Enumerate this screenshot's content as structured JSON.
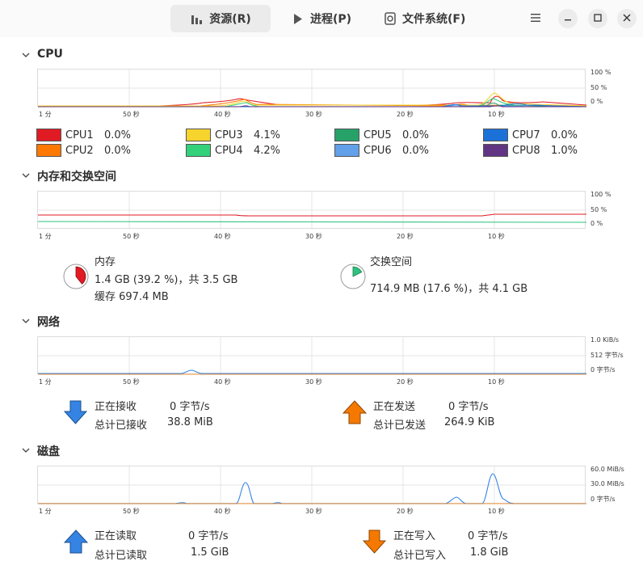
{
  "tabs": [
    {
      "label": "资源(R)",
      "icon": "bar-chart-icon",
      "active": true
    },
    {
      "label": "进程(P)",
      "icon": "play-icon",
      "active": false
    },
    {
      "label": "文件系统(F)",
      "icon": "disk-icon",
      "active": false
    }
  ],
  "window_buttons": [
    "menu-icon",
    "minimize-icon",
    "maximize-icon",
    "close-icon"
  ],
  "x_ticks": [
    "1 分",
    "50 秒",
    "40 秒",
    "30 秒",
    "20 秒",
    "10 秒"
  ],
  "cpu": {
    "title": "CPU",
    "y_ticks": [
      "100 %",
      "50 %",
      "0 %"
    ],
    "cores": [
      {
        "name": "CPU1",
        "value": "0.0%",
        "color": "#e01b24"
      },
      {
        "name": "CPU2",
        "value": "0.0%",
        "color": "#ff7800"
      },
      {
        "name": "CPU3",
        "value": "4.1%",
        "color": "#f6d32d"
      },
      {
        "name": "CPU4",
        "value": "4.2%",
        "color": "#33d17a"
      },
      {
        "name": "CPU5",
        "value": "0.0%",
        "color": "#26a269"
      },
      {
        "name": "CPU6",
        "value": "0.0%",
        "color": "#62a0ea"
      },
      {
        "name": "CPU7",
        "value": "0.0%",
        "color": "#1c71d8"
      },
      {
        "name": "CPU8",
        "value": "1.0%",
        "color": "#613583"
      }
    ]
  },
  "memory": {
    "title": "内存和交换空间",
    "y_ticks": [
      "100 %",
      "50 %",
      "0 %"
    ],
    "mem_label": "内存",
    "mem_usage": "1.4 GB (39.2 %)，共 3.5 GB",
    "mem_cache": "缓存 697.4 MB",
    "mem_color": "#e01b24",
    "mem_fraction": 0.392,
    "swap_label": "交换空间",
    "swap_usage": "714.9 MB (17.6 %)，共 4.1 GB",
    "swap_color": "#2ec27e",
    "swap_fraction": 0.176
  },
  "network": {
    "title": "网络",
    "y_ticks": [
      "1.0 KiB/s",
      "512 字节/s",
      "0 字节/s"
    ],
    "recv_label": "正在接收",
    "recv_value": "0 字节/s",
    "recv_total_label": "总计已接收",
    "recv_total": "38.8 MiB",
    "send_label": "正在发送",
    "send_value": "0 字节/s",
    "send_total_label": "总计已发送",
    "send_total": "264.9 KiB",
    "recv_color": "#3584e4",
    "send_color": "#f57900"
  },
  "disk": {
    "title": "磁盘",
    "y_ticks": [
      "60.0 MiB/s",
      "30.0 MiB/s",
      "0 字节/s"
    ],
    "read_label": "正在读取",
    "read_value": "0 字节/s",
    "read_total_label": "总计已读取",
    "read_total": "1.5 GiB",
    "write_label": "正在写入",
    "write_value": "0 字节/s",
    "write_total_label": "总计已写入",
    "write_total": "1.8 GiB",
    "read_color": "#3584e4",
    "write_color": "#f57900"
  }
}
